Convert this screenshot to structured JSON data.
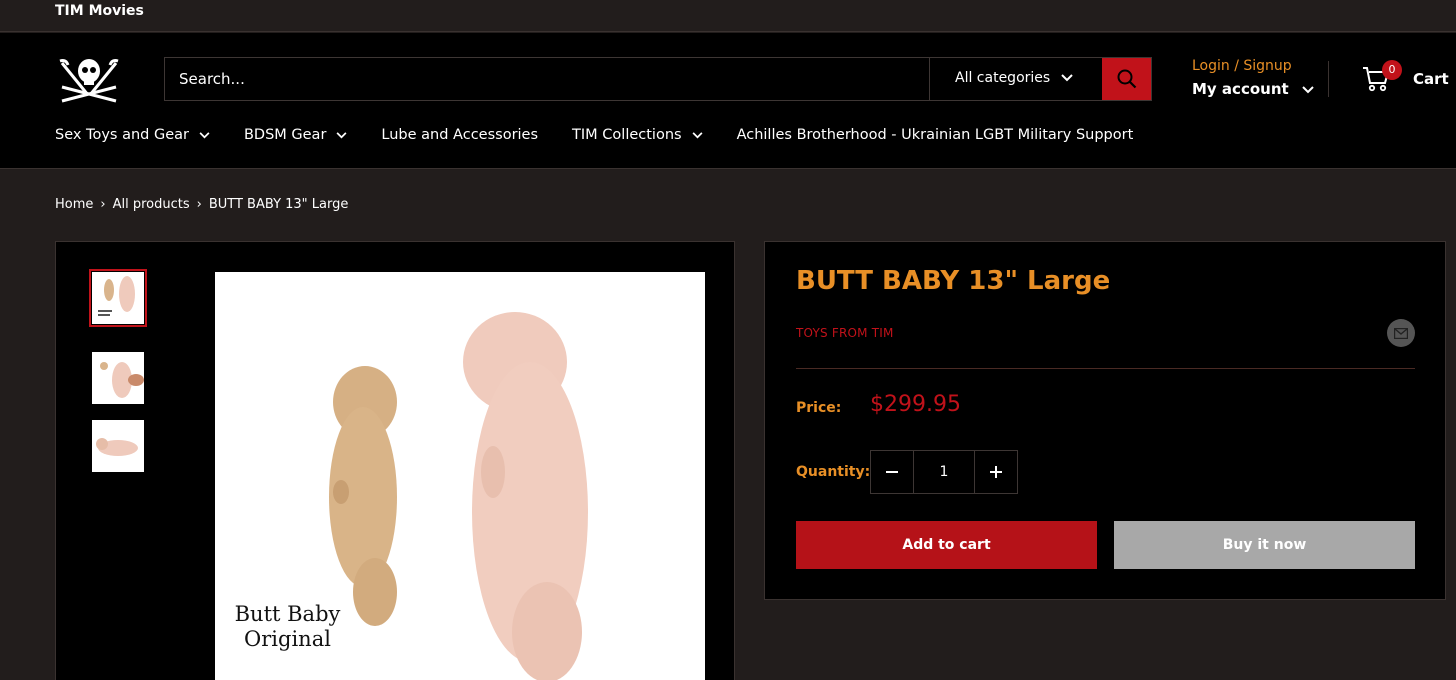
{
  "announcement": {
    "text": "TIM Movies"
  },
  "header": {
    "logo_icon": "jolly-roger-icon",
    "search": {
      "placeholder": "Search...",
      "category": "All categories",
      "icon": "search-icon"
    },
    "login_link": "Login / Signup",
    "account_label": "My account",
    "cart": {
      "count": "0",
      "label": "Cart",
      "icon": "cart-icon"
    },
    "nav": [
      {
        "label": "Sex Toys and Gear",
        "dropdown": true
      },
      {
        "label": "BDSM Gear",
        "dropdown": true
      },
      {
        "label": "Lube and Accessories",
        "dropdown": false
      },
      {
        "label": "TIM Collections",
        "dropdown": true
      },
      {
        "label": "Achilles Brotherhood - Ukrainian LGBT Military Support",
        "dropdown": false
      }
    ]
  },
  "breadcrumb": {
    "items": [
      "Home",
      "All products",
      "BUTT BABY 13\" Large"
    ],
    "separator": "›"
  },
  "gallery": {
    "thumbnail_count": 3,
    "main_caption": [
      "Butt Baby",
      "Original"
    ]
  },
  "product": {
    "title": "BUTT BABY 13\" Large",
    "vendor": "TOYS FROM TIM",
    "share_icon": "email-icon",
    "price_label": "Price:",
    "price": "$299.95",
    "quantity_label": "Quantity:",
    "quantity": "1",
    "add_to_cart": "Add to cart",
    "buy_now": "Buy it now"
  },
  "colors": {
    "background": "#221d1c",
    "header": "#000000",
    "accent_orange": "#e88f26",
    "accent_red": "#c1121a",
    "buy_now_gray": "#a8a8a8"
  }
}
